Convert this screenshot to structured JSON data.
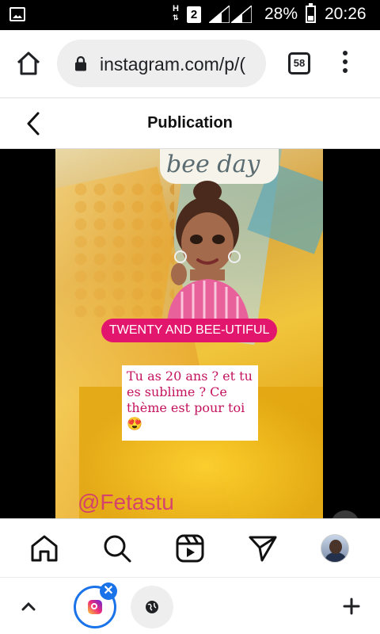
{
  "status_bar": {
    "network_type": "H",
    "sim_slot": "2",
    "battery_percent": "28%",
    "time": "20:26"
  },
  "browser": {
    "url": "instagram.com/p/(",
    "tab_count": "58"
  },
  "instagram": {
    "header_title": "Publication",
    "post": {
      "cup_text": "bee day",
      "tag_text": "TWENTY AND BEE-UTIFUL",
      "caption_text": "Tu as 20 ans ? et tu es sublime ? Ce thème est pour toi 😍",
      "watermark": "@Fetastu"
    },
    "nav_items": [
      "home-icon",
      "search-icon",
      "reels-icon",
      "direct-message-icon",
      "profile-avatar"
    ]
  },
  "colors": {
    "tag_pink": "#e3166e",
    "caption_text": "#c4125d",
    "active_tab_blue": "#1a73e8"
  }
}
